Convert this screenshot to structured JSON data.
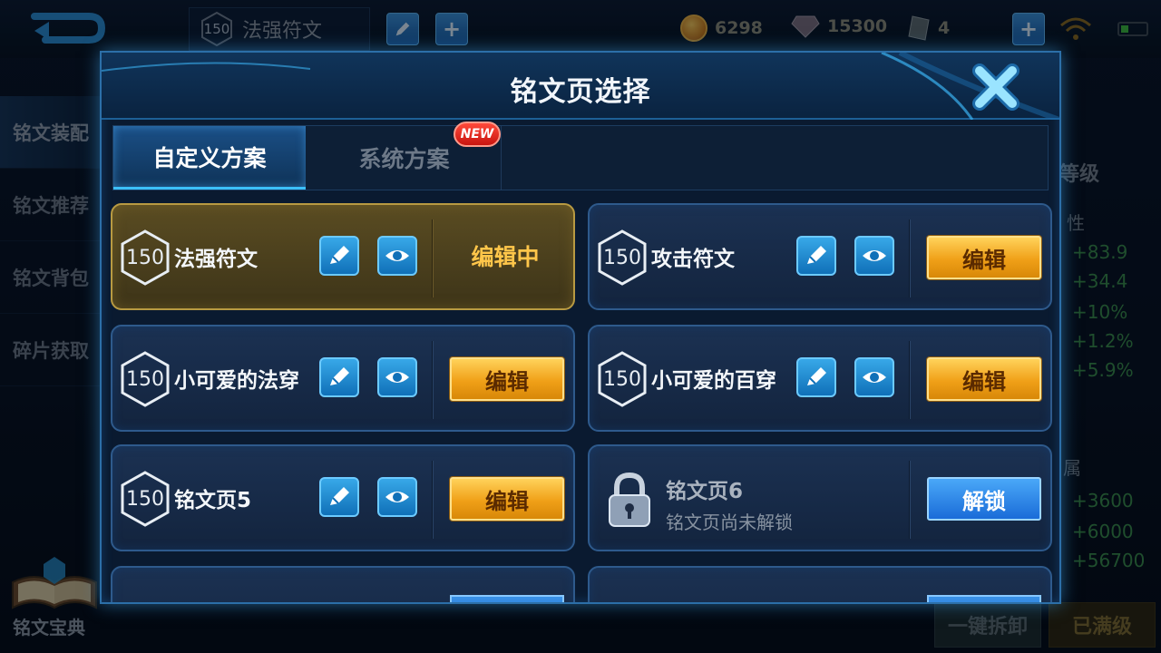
{
  "topbar": {
    "back_label": "back",
    "current_page": {
      "level": "150",
      "name": "法强符文"
    },
    "gold": "6298",
    "diamond": "15300",
    "rune_fragments": "4"
  },
  "left_nav": {
    "items": [
      "铭文装配",
      "铭文推荐",
      "铭文背包",
      "碎片获取"
    ],
    "book_label": "铭文宝典"
  },
  "right_panel": {
    "title": "等级",
    "attr_label": "性",
    "stats": [
      "+83.9",
      "+34.4",
      "+10%",
      "+1.2%",
      "+5.9%"
    ],
    "attr_label_2": "属",
    "stats2": [
      "+3600",
      "+6000",
      "+56700"
    ],
    "unload_all": "一键拆卸",
    "maxed": "已满级"
  },
  "modal": {
    "title": "铭文页选择",
    "tabs": {
      "custom": "自定义方案",
      "system": "系统方案",
      "new_badge": "NEW"
    },
    "pages": [
      {
        "level": "150",
        "name": "法强符文",
        "status": "编辑中"
      },
      {
        "level": "150",
        "name": "攻击符文",
        "action": "编辑"
      },
      {
        "level": "150",
        "name": "小可爱的法穿",
        "action": "编辑"
      },
      {
        "level": "150",
        "name": "小可爱的百穿",
        "action": "编辑"
      },
      {
        "level": "150",
        "name": "铭文页5",
        "action": "编辑"
      },
      {
        "name": "铭文页6",
        "desc": "铭文页尚未解锁",
        "action": "解锁"
      }
    ]
  },
  "colors": {
    "accent_blue": "#2c6fa8",
    "edit_gold": "#f0a018",
    "selected_gold": "#b89a42"
  }
}
